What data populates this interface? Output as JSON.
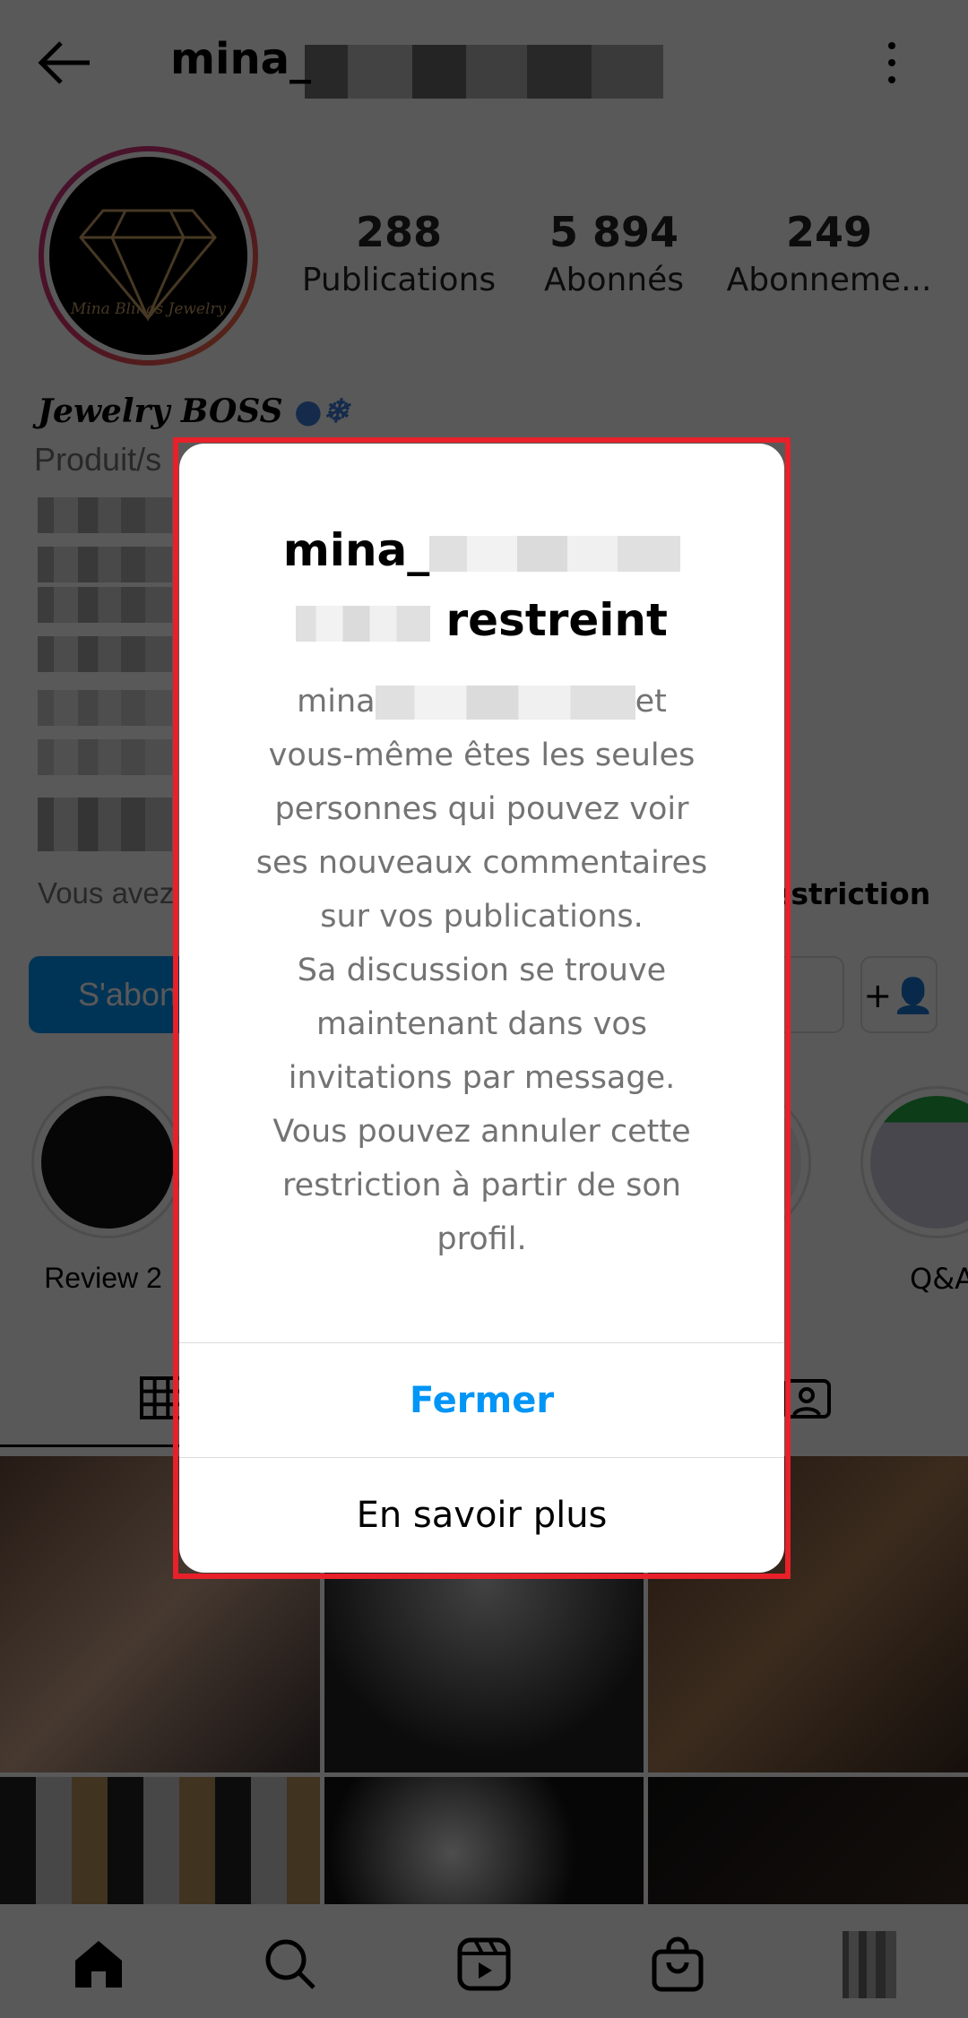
{
  "header": {
    "username_visible": "mina_",
    "back_icon": "arrow-left-icon",
    "menu_icon": "kebab-icon"
  },
  "profile": {
    "avatar_text": "Mina Blings Jewelry",
    "stats": [
      {
        "value": "288",
        "label": "Publications"
      },
      {
        "value": "5 894",
        "label": "Abonnés"
      },
      {
        "value": "249",
        "label": "Abonneme..."
      }
    ],
    "name": "Jewelry BOSS",
    "category": "Produit/s",
    "mutual_prefix": "Vous avez",
    "restriction_suffix": "estriction",
    "follow_label": "S'abon"
  },
  "highlights": [
    {
      "label": "Review 2"
    },
    {
      "label": "Q&A"
    }
  ],
  "modal": {
    "title_prefix": "mina_",
    "title_suffix": "restreint",
    "body_first_prefix": "mina",
    "body_first_suffix": "et",
    "body_lines": [
      "vous-même êtes les seules",
      "personnes qui pouvez voir",
      "ses nouveaux commentaires",
      "sur vos publications.",
      "Sa discussion se trouve",
      "maintenant dans vos",
      "invitations par message.",
      "Vous pouvez annuler cette",
      "restriction à partir de son",
      "profil."
    ],
    "primary_button": "Fermer",
    "secondary_button": "En savoir plus",
    "accent": "#0095f6",
    "highlight_border": "#e8202a"
  },
  "bottom_nav": [
    "home-icon",
    "search-icon",
    "reels-icon",
    "shop-icon",
    "profile-avatar"
  ]
}
